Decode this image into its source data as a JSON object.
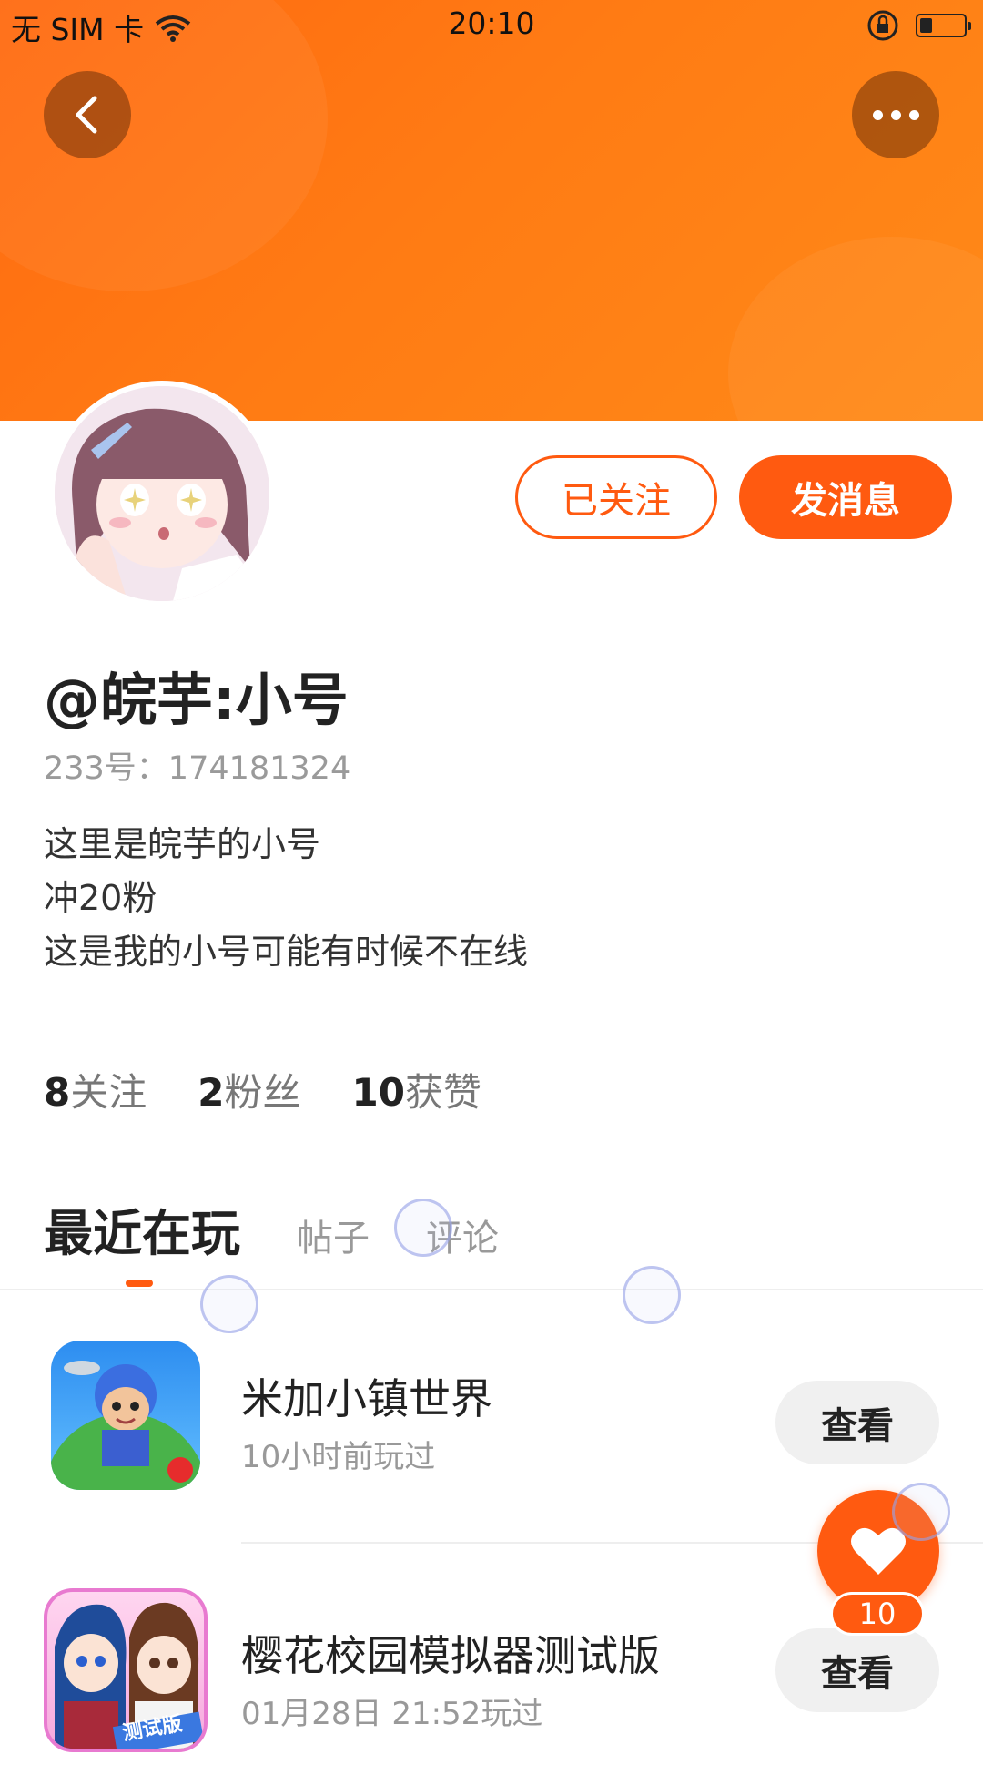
{
  "status_bar": {
    "carrier": "无 SIM 卡",
    "time": "20:10"
  },
  "profile": {
    "username": "@皖芋:小号",
    "uid": "233号：174181324",
    "bio": [
      "这里是皖芋的小号",
      "冲20粉",
      "这是我的小号可能有时候不在线"
    ],
    "follow_button": "已关注",
    "message_button": "发消息"
  },
  "stats": [
    {
      "value": "8",
      "label": "关注"
    },
    {
      "value": "2",
      "label": "粉丝"
    },
    {
      "value": "10",
      "label": "获赞"
    }
  ],
  "tabs": [
    {
      "label": "最近在玩",
      "active": true
    },
    {
      "label": "帖子",
      "active": false
    },
    {
      "label": "评论",
      "active": false
    }
  ],
  "games": [
    {
      "name": "米加小镇世界",
      "time": "10小时前玩过",
      "button": "查看"
    },
    {
      "name": "樱花校园模拟器测试版",
      "time": "01月28日 21:52玩过",
      "button": "查看",
      "badge": "测试版"
    }
  ],
  "like_fab": {
    "count": "10"
  },
  "colors": {
    "accent": "#ff5a10",
    "banner": "#ff7412"
  },
  "icons": [
    "back-arrow-icon",
    "more-dots-icon",
    "wifi-icon",
    "rotation-lock-icon",
    "battery-icon",
    "heart-icon"
  ]
}
